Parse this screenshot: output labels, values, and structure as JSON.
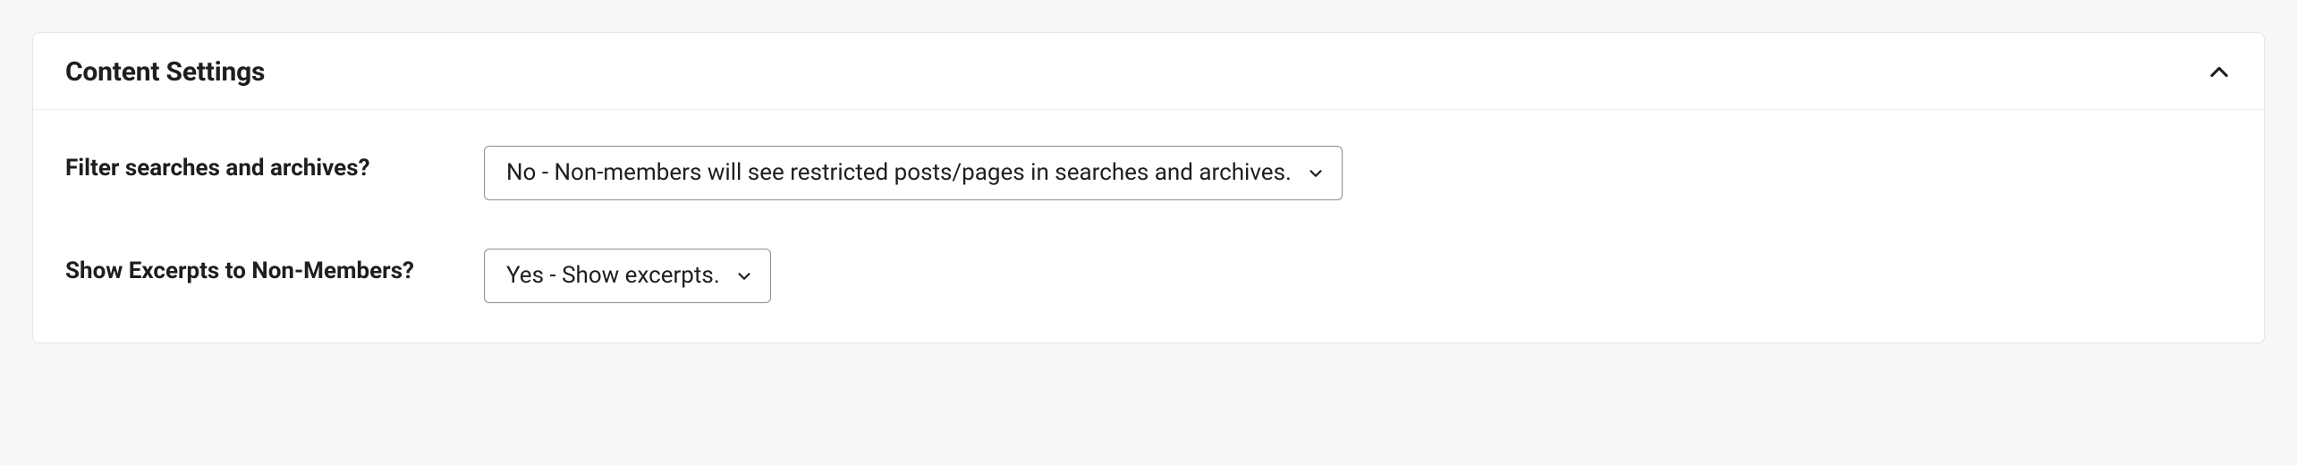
{
  "panel": {
    "title": "Content Settings"
  },
  "rows": {
    "filter": {
      "label": "Filter searches and archives?",
      "value": "No - Non-members will see restricted posts/pages in searches and archives."
    },
    "excerpts": {
      "label": "Show Excerpts to Non-Members?",
      "value": "Yes - Show excerpts."
    }
  }
}
